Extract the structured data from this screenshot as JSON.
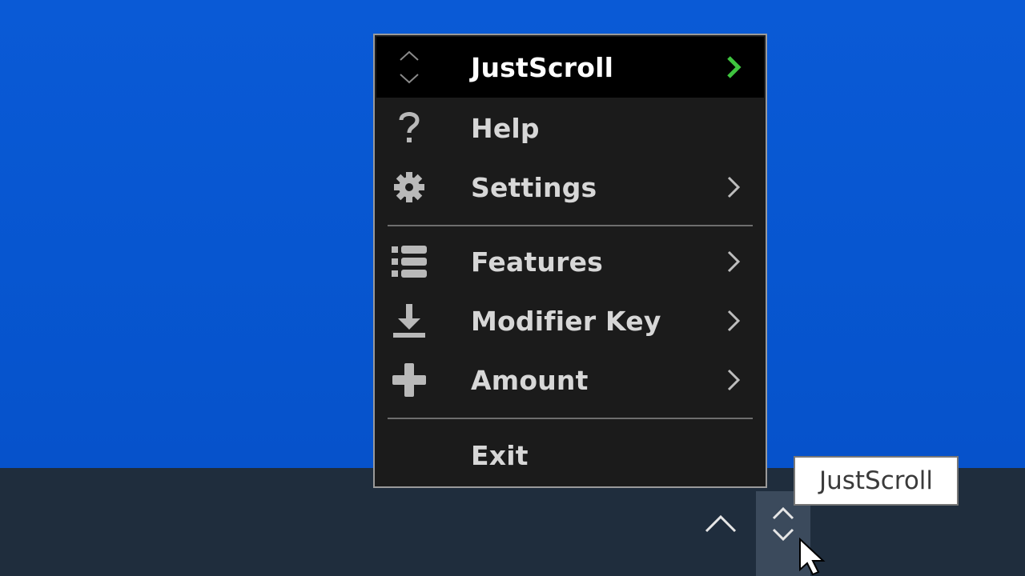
{
  "menu": {
    "header": {
      "label": "JustScroll",
      "icon": "scroll-updown-icon",
      "chevron_color": "#3fc43f"
    },
    "items": [
      {
        "label": "Help",
        "icon": "question-icon",
        "has_submenu": false
      },
      {
        "label": "Settings",
        "icon": "gear-icon",
        "has_submenu": true
      },
      {
        "label": "Features",
        "icon": "list-icon",
        "has_submenu": true
      },
      {
        "label": "Modifier Key",
        "icon": "download-icon",
        "has_submenu": true
      },
      {
        "label": "Amount",
        "icon": "plus-icon",
        "has_submenu": true
      },
      {
        "label": "Exit",
        "icon": "",
        "has_submenu": false
      }
    ]
  },
  "tooltip": {
    "text": "JustScroll"
  },
  "taskbar": {
    "tray_overflow_icon": "chevron-up-icon",
    "tray_app_icon": "scroll-updown-icon"
  },
  "colors": {
    "desktop": "#0756d0",
    "taskbar": "#1f2d3d",
    "menu_bg": "#1b1b1b",
    "menu_text": "#d7d7d7",
    "accent": "#3fc43f"
  }
}
